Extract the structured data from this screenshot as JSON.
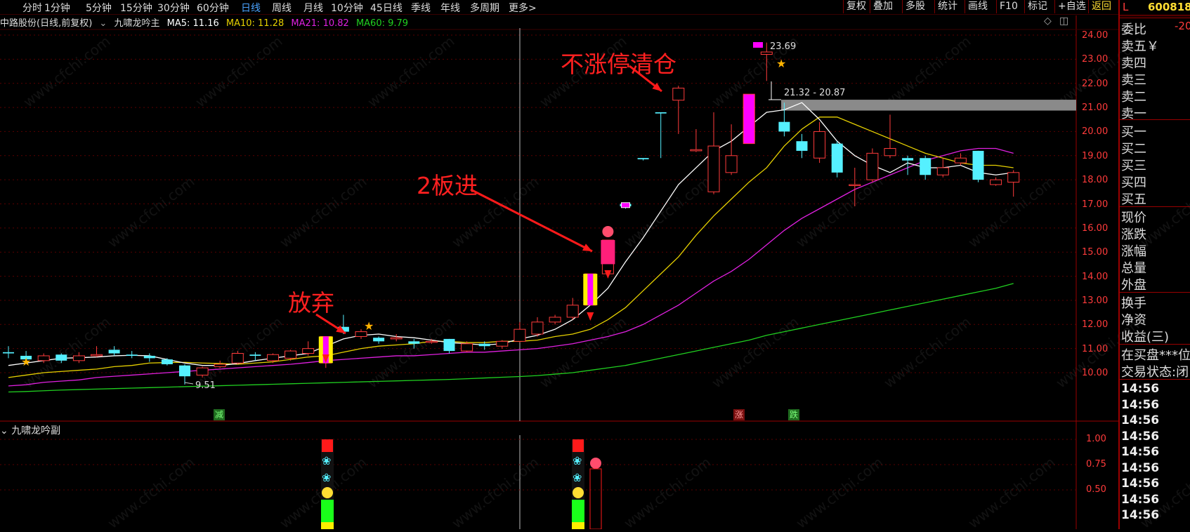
{
  "toolbar": {
    "periods": [
      "分时",
      "1分钟",
      "5分钟",
      "15分钟",
      "30分钟",
      "60分钟",
      "日线",
      "周线",
      "月线",
      "10分钟",
      "45日线",
      "季线",
      "年线",
      "多周期",
      "更多>"
    ],
    "active_period": "日线",
    "buttons": [
      "复权",
      "叠加",
      "多股",
      "统计",
      "画线",
      "F10",
      "标记",
      "+自选",
      "返回"
    ]
  },
  "legend": {
    "stock": "中路股份(日线,前复权)",
    "indicator": "九啸龙吟主",
    "ma5": "MA5: 11.16",
    "ma10": "MA10: 11.28",
    "ma21": "MA21: 10.82",
    "ma60": "MA60: 9.79"
  },
  "colors": {
    "ma5": "#ffffff",
    "ma10": "#e6d000",
    "ma21": "#e020e0",
    "ma60": "#20d020",
    "up": "#ff3b3b",
    "down": "#55f0ff",
    "grid": "#5a0000"
  },
  "price_axis": [
    "24.00",
    "23.00",
    "22.00",
    "21.00",
    "20.00",
    "19.00",
    "18.00",
    "17.00",
    "16.00",
    "15.00",
    "14.00",
    "13.00",
    "12.00",
    "11.00",
    "10.00"
  ],
  "osc_axis": [
    "1.00",
    "0.75",
    "0.50"
  ],
  "annotations": {
    "abandon": "放弃",
    "two_board": "2板进",
    "clear": "不涨停清仓",
    "high": "23.69",
    "low": "9.51",
    "range": "21.32 - 20.87"
  },
  "markers": {
    "jian": "减",
    "zhang": "涨",
    "die": "跌"
  },
  "sub_indicator": "九啸龙吟副",
  "watermark": "www.cfchi.com",
  "right_panel": {
    "code": "600818",
    "L": "L",
    "rows": [
      "委比",
      "卖五￥",
      "卖四",
      "卖三",
      "卖二",
      "卖一",
      "买一",
      "买二",
      "买三",
      "买四",
      "买五",
      "现价",
      "涨跌",
      "涨幅",
      "总量",
      "外盘",
      "换手",
      "净资",
      "收益(三)",
      "在买盘***位",
      "交易状态:闭"
    ],
    "wei_bi_val": "-20",
    "times": [
      "14:56",
      "14:56",
      "14:56",
      "14:56",
      "14:56",
      "14:56",
      "14:56",
      "14:56",
      "14:56"
    ]
  },
  "chart_data": {
    "type": "candlestick",
    "indicator_lines": [
      "MA5",
      "MA10",
      "MA21",
      "MA60"
    ],
    "candles": [
      {
        "o": 10.85,
        "c": 10.8,
        "h": 11.1,
        "l": 10.6
      },
      {
        "o": 10.7,
        "c": 10.55,
        "h": 10.9,
        "l": 10.4
      },
      {
        "o": 10.5,
        "c": 10.7,
        "h": 10.8,
        "l": 10.4
      },
      {
        "o": 10.75,
        "c": 10.5,
        "h": 10.8,
        "l": 10.4
      },
      {
        "o": 10.5,
        "c": 10.7,
        "h": 10.85,
        "l": 10.4
      },
      {
        "o": 10.7,
        "c": 10.75,
        "h": 11.1,
        "l": 10.65
      },
      {
        "o": 10.95,
        "c": 10.8,
        "h": 11.1,
        "l": 10.7
      },
      {
        "o": 10.75,
        "c": 10.7,
        "h": 10.9,
        "l": 10.6
      },
      {
        "o": 10.7,
        "c": 10.6,
        "h": 10.8,
        "l": 10.45
      },
      {
        "o": 10.55,
        "c": 10.35,
        "h": 10.6,
        "l": 10.3
      },
      {
        "o": 10.3,
        "c": 9.85,
        "h": 10.35,
        "l": 9.51
      },
      {
        "o": 9.9,
        "c": 10.2,
        "h": 10.25,
        "l": 9.8
      },
      {
        "o": 10.25,
        "c": 10.35,
        "h": 10.5,
        "l": 10.2
      },
      {
        "o": 10.4,
        "c": 10.8,
        "h": 10.9,
        "l": 10.35
      },
      {
        "o": 10.75,
        "c": 10.7,
        "h": 10.85,
        "l": 10.5
      },
      {
        "o": 10.5,
        "c": 10.75,
        "h": 10.8,
        "l": 10.4
      },
      {
        "o": 10.6,
        "c": 10.9,
        "h": 10.95,
        "l": 10.5
      },
      {
        "o": 10.8,
        "c": 11.0,
        "h": 11.3,
        "l": 10.7
      },
      {
        "o": 10.4,
        "c": 11.5,
        "h": 11.5,
        "l": 10.2
      },
      {
        "o": 11.9,
        "c": 11.7,
        "h": 12.4,
        "l": 11.6
      },
      {
        "o": 11.5,
        "c": 11.7,
        "h": 11.8,
        "l": 11.4
      },
      {
        "o": 11.45,
        "c": 11.3,
        "h": 11.5,
        "l": 11.2
      },
      {
        "o": 11.4,
        "c": 11.45,
        "h": 11.6,
        "l": 11.3
      },
      {
        "o": 11.3,
        "c": 11.2,
        "h": 11.4,
        "l": 11.0
      },
      {
        "o": 11.3,
        "c": 11.3,
        "h": 11.4,
        "l": 11.2
      },
      {
        "o": 11.4,
        "c": 10.9,
        "h": 11.4,
        "l": 10.8
      },
      {
        "o": 10.9,
        "c": 11.2,
        "h": 11.3,
        "l": 10.85
      },
      {
        "o": 11.2,
        "c": 11.1,
        "h": 11.3,
        "l": 10.95
      },
      {
        "o": 11.1,
        "c": 11.3,
        "h": 11.35,
        "l": 11.0
      },
      {
        "o": 11.3,
        "c": 11.8,
        "h": 12.1,
        "l": 11.25
      },
      {
        "o": 11.6,
        "c": 12.1,
        "h": 12.3,
        "l": 11.5
      },
      {
        "o": 12.1,
        "c": 12.3,
        "h": 12.4,
        "l": 12.0
      },
      {
        "o": 12.3,
        "c": 12.8,
        "h": 13.1,
        "l": 12.2
      },
      {
        "o": 12.8,
        "c": 14.1,
        "h": 14.1,
        "l": 12.8
      },
      {
        "o": 14.1,
        "c": 15.5,
        "h": 15.5,
        "l": 14.0
      },
      {
        "o": 17.0,
        "c": 16.9,
        "h": 17.0,
        "l": 16.8
      },
      {
        "o": 18.9,
        "c": 18.85,
        "h": 18.9,
        "l": 18.8
      },
      {
        "o": 20.8,
        "c": 20.75,
        "h": 20.8,
        "l": 18.9
      },
      {
        "o": 21.3,
        "c": 21.8,
        "h": 21.9,
        "l": 19.9
      },
      {
        "o": 19.2,
        "c": 19.25,
        "h": 20.1,
        "l": 19.15
      },
      {
        "o": 17.5,
        "c": 19.4,
        "h": 20.8,
        "l": 17.4
      },
      {
        "o": 18.3,
        "c": 19.0,
        "h": 20.3,
        "l": 18.2
      },
      {
        "o": 19.6,
        "c": 21.5,
        "h": 21.5,
        "l": 19.5
      },
      {
        "o": 23.2,
        "c": 23.3,
        "h": 23.69,
        "l": 22.1
      },
      {
        "o": 20.4,
        "c": 20.0,
        "h": 21.2,
        "l": 19.8
      },
      {
        "o": 19.6,
        "c": 19.2,
        "h": 19.9,
        "l": 18.9
      },
      {
        "o": 18.9,
        "c": 20.0,
        "h": 20.4,
        "l": 18.7
      },
      {
        "o": 19.5,
        "c": 18.3,
        "h": 19.6,
        "l": 18.1
      },
      {
        "o": 17.8,
        "c": 17.8,
        "h": 18.5,
        "l": 16.9
      },
      {
        "o": 18.0,
        "c": 19.1,
        "h": 19.3,
        "l": 17.9
      },
      {
        "o": 19.0,
        "c": 19.3,
        "h": 20.7,
        "l": 18.9
      },
      {
        "o": 18.9,
        "c": 18.8,
        "h": 19.0,
        "l": 18.2
      },
      {
        "o": 18.9,
        "c": 18.2,
        "h": 19.0,
        "l": 18.0
      },
      {
        "o": 18.2,
        "c": 18.5,
        "h": 18.9,
        "l": 18.1
      },
      {
        "o": 18.7,
        "c": 18.9,
        "h": 19.1,
        "l": 18.6
      },
      {
        "o": 19.2,
        "c": 18.0,
        "h": 19.2,
        "l": 17.9
      },
      {
        "o": 17.8,
        "c": 18.0,
        "h": 18.1,
        "l": 17.75
      },
      {
        "o": 17.9,
        "c": 18.3,
        "h": 18.4,
        "l": 17.3
      }
    ],
    "ma5": [
      10.3,
      10.4,
      10.5,
      10.6,
      10.62,
      10.65,
      10.7,
      10.72,
      10.7,
      10.55,
      10.4,
      10.3,
      10.3,
      10.38,
      10.5,
      10.6,
      10.7,
      10.8,
      11.1,
      11.4,
      11.55,
      11.6,
      11.5,
      11.45,
      11.35,
      11.25,
      11.2,
      11.15,
      11.2,
      11.4,
      11.55,
      11.8,
      12.2,
      12.8,
      13.5,
      14.6,
      15.6,
      16.7,
      17.8,
      18.5,
      19.2,
      19.6,
      20.2,
      20.8,
      20.9,
      21.2,
      20.5,
      19.6,
      19.0,
      18.6,
      18.3,
      18.7,
      18.5,
      18.5,
      18.6,
      18.3,
      18.2,
      18.3
    ],
    "ma10": [
      9.8,
      9.9,
      10.0,
      10.05,
      10.1,
      10.15,
      10.25,
      10.3,
      10.4,
      10.42,
      10.43,
      10.4,
      10.38,
      10.35,
      10.4,
      10.45,
      10.55,
      10.65,
      10.7,
      10.85,
      11.0,
      11.1,
      11.15,
      11.2,
      11.3,
      11.3,
      11.25,
      11.25,
      11.3,
      11.3,
      11.35,
      11.5,
      11.6,
      11.8,
      12.2,
      12.7,
      13.4,
      14.1,
      14.8,
      15.7,
      16.5,
      17.2,
      17.9,
      18.5,
      19.4,
      20.1,
      20.6,
      20.6,
      20.3,
      20.0,
      19.7,
      19.4,
      19.1,
      18.9,
      18.7,
      18.6,
      18.6,
      18.5
    ],
    "ma21": [
      9.45,
      9.5,
      9.6,
      9.65,
      9.7,
      9.8,
      9.85,
      9.9,
      9.95,
      10.0,
      10.05,
      10.1,
      10.15,
      10.2,
      10.25,
      10.3,
      10.35,
      10.42,
      10.5,
      10.55,
      10.6,
      10.65,
      10.7,
      10.7,
      10.75,
      10.8,
      10.85,
      10.85,
      10.9,
      10.95,
      11.0,
      11.1,
      11.2,
      11.35,
      11.5,
      11.7,
      12.0,
      12.4,
      12.8,
      13.3,
      13.8,
      14.2,
      14.7,
      15.3,
      15.9,
      16.4,
      16.8,
      17.2,
      17.6,
      17.9,
      18.2,
      18.5,
      18.8,
      19.0,
      19.2,
      19.3,
      19.3,
      19.1
    ],
    "ma60": [
      9.2,
      9.22,
      9.25,
      9.28,
      9.3,
      9.32,
      9.34,
      9.36,
      9.38,
      9.4,
      9.42,
      9.44,
      9.46,
      9.48,
      9.5,
      9.52,
      9.54,
      9.56,
      9.58,
      9.6,
      9.62,
      9.64,
      9.66,
      9.68,
      9.7,
      9.72,
      9.75,
      9.78,
      9.81,
      9.84,
      9.88,
      9.94,
      10.0,
      10.1,
      10.2,
      10.3,
      10.45,
      10.6,
      10.75,
      10.9,
      11.05,
      11.2,
      11.35,
      11.55,
      11.7,
      11.85,
      12.0,
      12.15,
      12.3,
      12.45,
      12.6,
      12.75,
      12.9,
      13.05,
      13.2,
      13.35,
      13.5,
      13.7
    ],
    "ylim": [
      9.0,
      24.3
    ],
    "range_band": [
      20.87,
      21.32
    ],
    "high_label": 23.69,
    "low_label": 9.51
  }
}
